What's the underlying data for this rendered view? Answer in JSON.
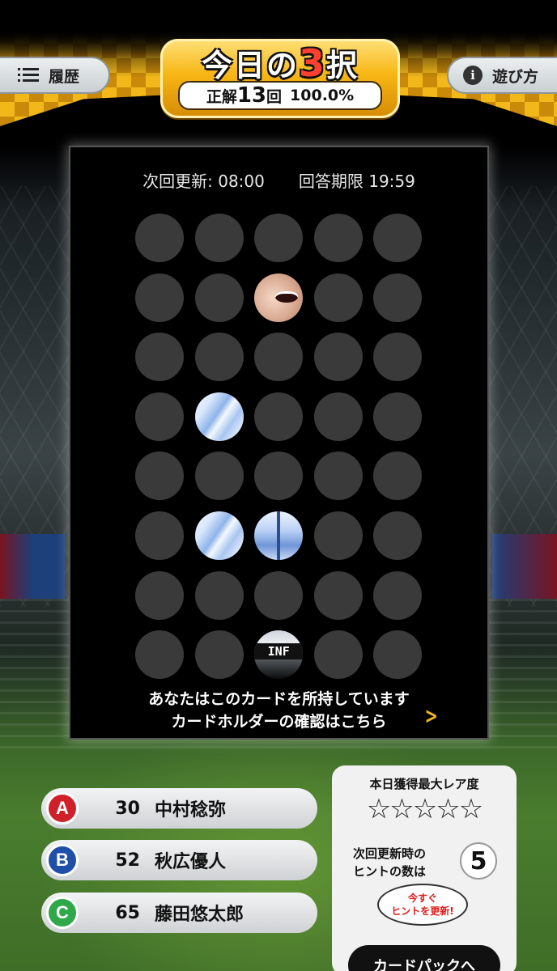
{
  "header": {
    "history_label": "履歴",
    "title_prefix": "今日の",
    "title_num": "3",
    "title_suffix": "択",
    "correct_prefix": "正解",
    "correct_count": "13",
    "correct_suffix": "回",
    "accuracy": "100.0%",
    "howto_label": "遊び方"
  },
  "puzzle": {
    "next_update": "次回更新: 08:00",
    "deadline": "回答期限 19:59",
    "revealed_text": "INF",
    "owned_line1": "あなたはこのカードを所持しています",
    "owned_line2": "カードホルダーの確認はこちら"
  },
  "answers": [
    {
      "letter": "A",
      "number": "30",
      "name": "中村稔弥",
      "color": "#d0202a"
    },
    {
      "letter": "B",
      "number": "52",
      "name": "秋広優人",
      "color": "#1f4fa8"
    },
    {
      "letter": "C",
      "number": "65",
      "name": "藤田悠太郎",
      "color": "#2fa84a"
    }
  ],
  "rarity": {
    "title": "本日獲得最大レア度",
    "stars": "☆☆☆☆☆",
    "hint_label_1": "次回更新時の",
    "hint_label_2": "ヒントの数は",
    "hint_count": "5",
    "refresh_1": "今すぐ",
    "refresh_2": "ヒントを更新!",
    "cardpack": "カードパックへ"
  },
  "colors": {
    "accent_gold": "#f2b81a",
    "chevron": "#f5b41c"
  }
}
